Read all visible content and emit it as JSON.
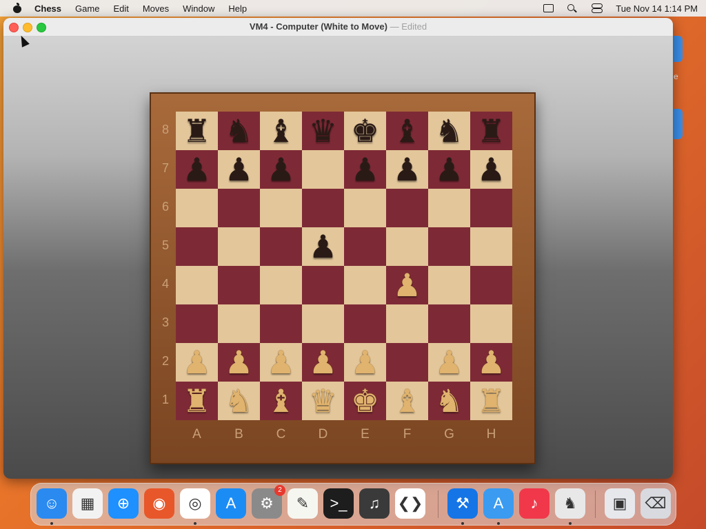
{
  "menubar": {
    "app_name": "Chess",
    "items": [
      "Game",
      "Edit",
      "Moves",
      "Window",
      "Help"
    ],
    "clock": "Tue Nov 14  1:14 PM"
  },
  "window": {
    "title": "VM4 - Computer   (White to Move)",
    "separator": "—",
    "edited": "Edited"
  },
  "board": {
    "ranks": [
      "8",
      "7",
      "6",
      "5",
      "4",
      "3",
      "2",
      "1"
    ],
    "files": [
      "A",
      "B",
      "C",
      "D",
      "E",
      "F",
      "G",
      "H"
    ],
    "position": [
      [
        "br",
        "bn",
        "bb",
        "bq",
        "bk",
        "bb",
        "bn",
        "br"
      ],
      [
        "bp",
        "bp",
        "bp",
        "",
        "bp",
        "bp",
        "bp",
        "bp"
      ],
      [
        "",
        "",
        "",
        "",
        "",
        "",
        "",
        ""
      ],
      [
        "",
        "",
        "",
        "bp",
        "",
        "",
        "",
        ""
      ],
      [
        "",
        "",
        "",
        "",
        "",
        "wp",
        "",
        ""
      ],
      [
        "",
        "",
        "",
        "",
        "",
        "",
        "",
        ""
      ],
      [
        "wp",
        "wp",
        "wp",
        "wp",
        "wp",
        "",
        "wp",
        "wp"
      ],
      [
        "wr",
        "wn",
        "wb",
        "wq",
        "wk",
        "wb",
        "wn",
        "wr"
      ]
    ],
    "colors": {
      "light": "#e3c69a",
      "dark": "#7e2a36"
    }
  },
  "dock": {
    "apps": [
      {
        "name": "finder-icon",
        "glyph": "☺",
        "color": "#2a8af0",
        "running": true
      },
      {
        "name": "launchpad-icon",
        "glyph": "▦",
        "color": "#f2f2f2",
        "running": false
      },
      {
        "name": "safari-icon",
        "glyph": "⊕",
        "color": "#1e90ff",
        "running": false
      },
      {
        "name": "firefox-icon",
        "glyph": "◉",
        "color": "#e8572a",
        "running": false
      },
      {
        "name": "chrome-icon",
        "glyph": "◎",
        "color": "#ffffff",
        "running": true
      },
      {
        "name": "app-store-icon",
        "glyph": "A",
        "color": "#1c8cf5",
        "running": false
      },
      {
        "name": "system-settings-icon",
        "glyph": "⚙",
        "color": "#8a8a8a",
        "running": false,
        "badge": "2"
      },
      {
        "name": "textedit-icon",
        "glyph": "✎",
        "color": "#f6f6f0",
        "running": false
      },
      {
        "name": "terminal-icon",
        "glyph": ">_",
        "color": "#1d1d1d",
        "running": false
      },
      {
        "name": "garageband-icon",
        "glyph": "♫",
        "color": "#3a3a3a",
        "running": false
      },
      {
        "name": "vscode-icon",
        "glyph": "❮❯",
        "color": "#ffffff",
        "running": false
      },
      {
        "name": "xcode-icon",
        "glyph": "⚒",
        "color": "#1575e6",
        "running": true
      },
      {
        "name": "simulator-icon",
        "glyph": "A",
        "color": "#3a9bf0",
        "running": true
      },
      {
        "name": "music-icon",
        "glyph": "♪",
        "color": "#f0384a",
        "running": false
      },
      {
        "name": "chess-icon",
        "glyph": "♞",
        "color": "#e8e8e8",
        "running": true
      },
      {
        "name": "preview-icon",
        "glyph": "▣",
        "color": "#e6e8ec",
        "running": false
      },
      {
        "name": "trash-icon",
        "glyph": "⌫",
        "color": "#d8dadf",
        "running": false
      }
    ]
  }
}
